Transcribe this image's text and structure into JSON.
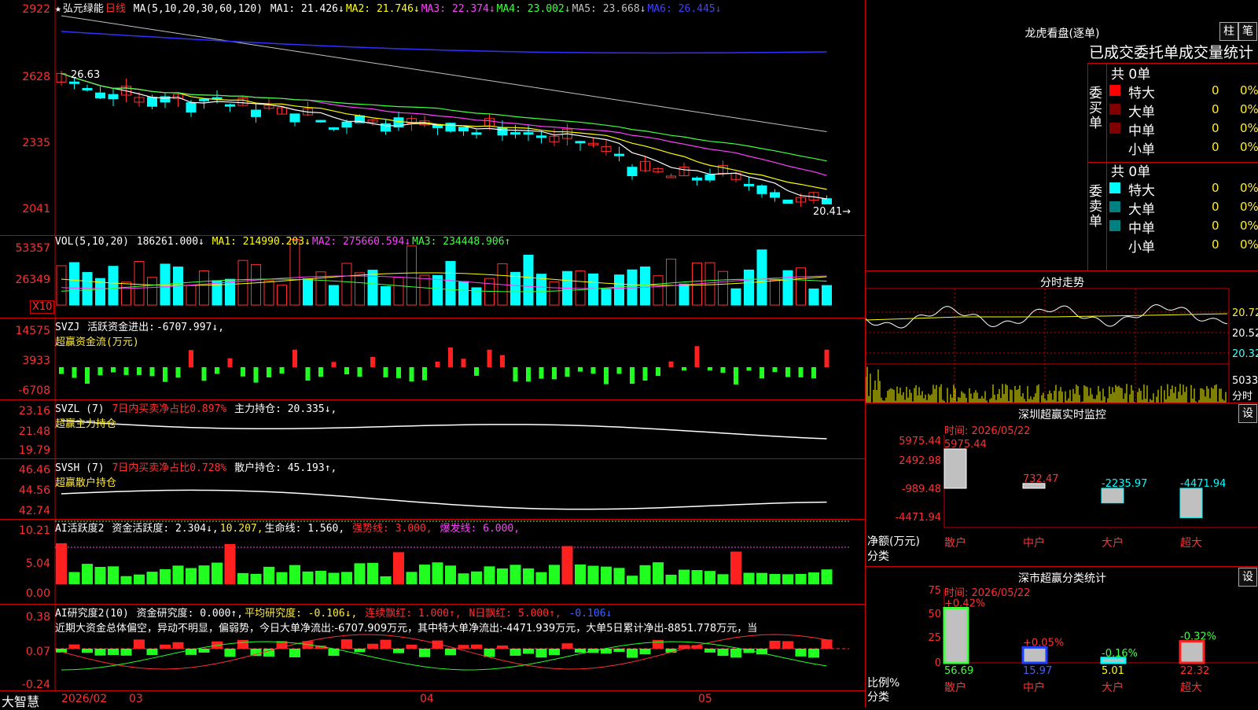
{
  "stock": {
    "name": "弘元绿能",
    "period": "日线",
    "ma_label": "MA(5,10,20,30,60,120)",
    "ma": [
      {
        "name": "MA1:",
        "value": "21.426↓",
        "color": "#ffffff"
      },
      {
        "name": "MA2:",
        "value": "21.746↓",
        "color": "#ffff00"
      },
      {
        "name": "MA3:",
        "value": "22.374↓",
        "color": "#ff40ff"
      },
      {
        "name": "MA4:",
        "value": "23.002↓",
        "color": "#40ff40"
      },
      {
        "name": "MA5:",
        "value": "23.668↓",
        "color": "#c0c0c0"
      },
      {
        "name": "MA6:",
        "value": "26.445↓",
        "color": "#4040ff"
      }
    ],
    "price_axis": [
      "2922",
      "2628",
      "2335",
      "2041"
    ],
    "high_mark": "26.63",
    "low_mark": "20.41"
  },
  "vol": {
    "label": "VOL(5,10,20)",
    "value": "186261.000↓",
    "ma": [
      {
        "name": "MA1:",
        "value": "214990.203↓",
        "color": "#ffff00"
      },
      {
        "name": "MA2:",
        "value": "275660.594↓",
        "color": "#ff40ff"
      },
      {
        "name": "MA3:",
        "value": "234448.906↑",
        "color": "#40ff40"
      }
    ],
    "axis": [
      "53357",
      "26349"
    ],
    "unit": "X10"
  },
  "svzj": {
    "label": "SVZJ",
    "desc": "活跃资金进出:",
    "value": "-6707.997↓,",
    "sub": "超赢资金流(万元)",
    "axis": [
      "14575",
      "3933",
      "-6708"
    ]
  },
  "svzl": {
    "label": "SVZL (7)",
    "desc": "7日内买卖净占比0.897%",
    "hold": "主力持仓: 20.335↓,",
    "sub": "超赢主力持仓",
    "axis": [
      "23.16",
      "21.48",
      "19.79"
    ]
  },
  "svsh": {
    "label": "SVSH (7)",
    "desc": "7日内买卖净占比0.728%",
    "hold": "散户持仓: 45.193↑,",
    "sub": "超赢散户持仓",
    "axis": [
      "46.46",
      "44.56",
      "42.74"
    ]
  },
  "ai1": {
    "label": "AI活跃度2",
    "t1": "资金活跃度: 2.304↓,",
    "t2": "10.207,",
    "t3": "生命线: 1.560,",
    "t4": "强势线: 3.000,",
    "t5": "爆发线: 6.000,",
    "axis": [
      "10.21",
      "5.04",
      "0.00"
    ]
  },
  "ai2": {
    "label": "AI研究度2(10)",
    "t1": "资金研究度: 0.000↑,",
    "t2": "平均研究度: -0.106↓,",
    "t3": "连续飘红: 1.000↑,",
    "t4": "N日飘红: 5.000↑,",
    "t5": "-0.106↓",
    "comment": "近期大资金总体偏空，异动不明显，偏弱势，今日大单净流出:-6707.909万元，其中特大单净流出:-4471.939万元，大单5日累计净出-8851.778万元，当",
    "axis": [
      "0.38",
      "0.07",
      "-0.24"
    ]
  },
  "bottom": {
    "brand": "大智慧",
    "date": "2026/02",
    "months": [
      "03",
      "04",
      "05"
    ]
  },
  "right": {
    "lhb_title": "龙虎看盘(逐单)",
    "btn1": "柱",
    "btn2": "笔",
    "tabs": "已成交委托单成交量统计",
    "buy_side": "委买单",
    "sell_side": "委卖单",
    "total": "共 0单",
    "rows": [
      "特大",
      "大单",
      "中单",
      "小单"
    ],
    "zero": "0",
    "pct": "0%",
    "buy_colors": [
      "#ff0000",
      "#800000",
      "#800000",
      ""
    ],
    "sell_colors": [
      "#00ffff",
      "#008080",
      "#008080",
      ""
    ],
    "fenshi_title": "分时走势",
    "fenshi_axis": [
      "20.72",
      "20.52",
      "20.32"
    ],
    "fenshi_vol": "5033",
    "fenshi_unit": "分时",
    "sz_title": "深圳超赢实时监控",
    "set": "设",
    "time": "时间: 2026/05/22",
    "sz_axis": [
      "5975.44",
      "2492.98",
      "-989.48",
      "-4471.94"
    ],
    "sz_vals": [
      "5975.44",
      "732.47",
      "-2235.97",
      "-4471.94"
    ],
    "sz_ylbl": "净额(万元)",
    "cat_lbl": "分类",
    "cats": [
      "散户",
      "中户",
      "大户",
      "超大"
    ],
    "ss_title": "深市超赢分类统计",
    "ss_axis": [
      "75",
      "50",
      "25",
      "0"
    ],
    "ss_pct": [
      "+0.42%",
      "+0.05%",
      "-0.16%",
      "-0.32%"
    ],
    "ss_vals": [
      "56.69",
      "15.97",
      "5.01",
      "22.32"
    ],
    "ss_ylbl": "比例%"
  }
}
